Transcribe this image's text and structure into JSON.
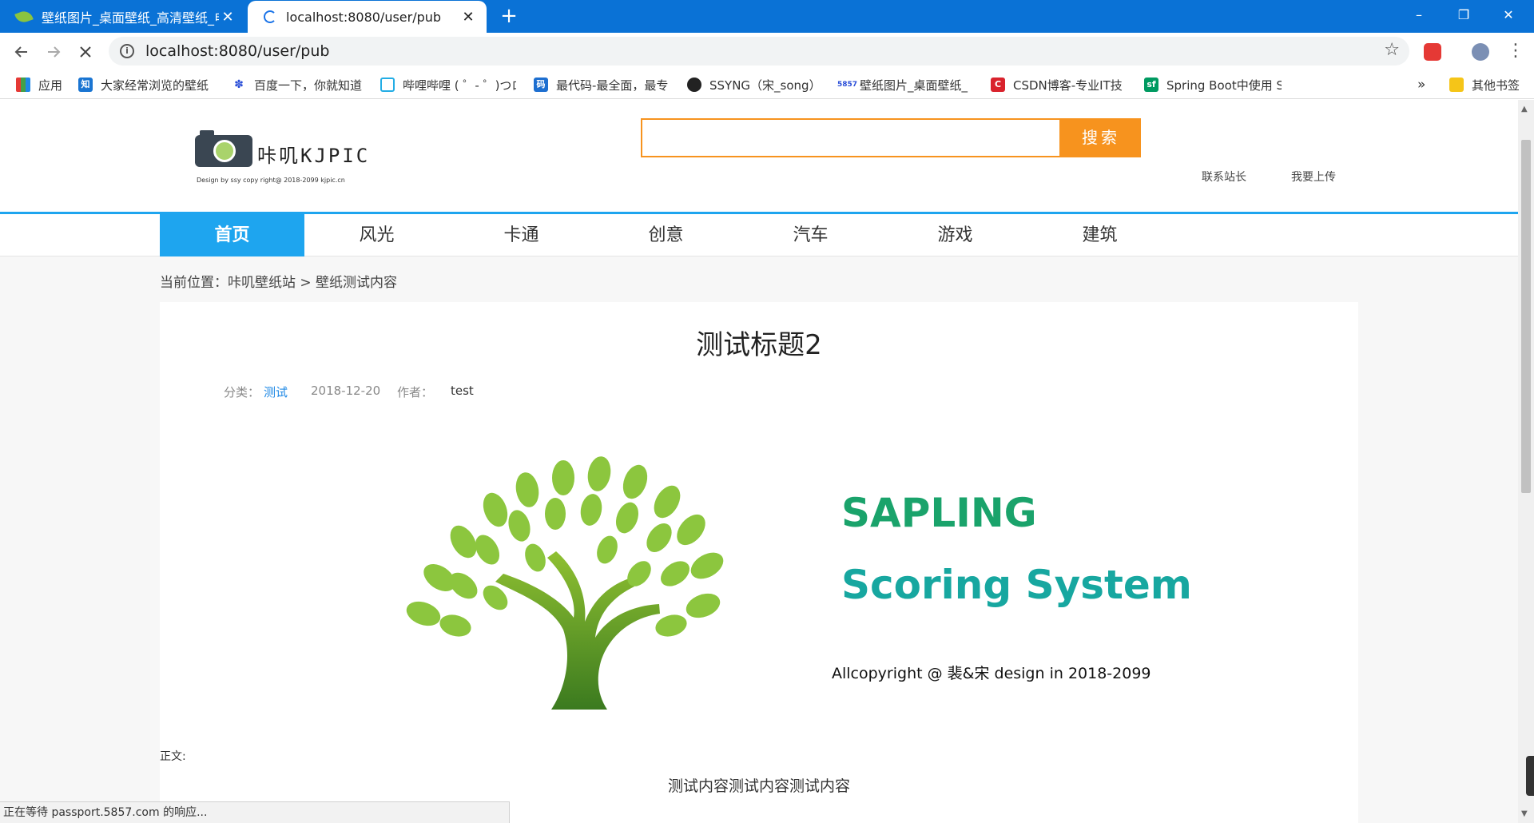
{
  "browser": {
    "tabs": [
      {
        "title": "壁纸图片_桌面壁纸_高清壁纸_电",
        "favicon": "leaf-icon",
        "active": false
      },
      {
        "title": "localhost:8080/user/pub",
        "favicon": "loading-icon",
        "active": true
      }
    ],
    "new_tab_label": "+",
    "window_controls": {
      "minimize": "–",
      "maximize": "❐",
      "close": "✕"
    },
    "url": "localhost:8080/user/pub",
    "bookmarks": [
      {
        "label": "应用",
        "icon": "apps-grid-icon"
      },
      {
        "label": "大家经常浏览的壁纸",
        "icon": "zhihu-icon"
      },
      {
        "label": "百度一下，你就知道",
        "icon": "baidu-paw-icon"
      },
      {
        "label": "哔哩哔哩 ( ゜- ゜)つロ",
        "icon": "bilibili-icon"
      },
      {
        "label": "最代码-最全面，最专",
        "icon": "zuidaima-icon"
      },
      {
        "label": "SSYNG（宋_song）",
        "icon": "github-icon"
      },
      {
        "label": "壁纸图片_桌面壁纸_",
        "icon": "5857-icon"
      },
      {
        "label": "CSDN博客-专业IT技",
        "icon": "csdn-icon"
      },
      {
        "label": "Spring Boot中使用 S",
        "icon": "segmentfault-icon"
      }
    ],
    "overflow_label": "»",
    "other_bookmarks": "其他书签",
    "status": "正在等待 passport.5857.com 的响应..."
  },
  "site": {
    "brand": "咔叽KJPIC",
    "tagline": "Design by ssy copy right@ 2018-2099  kjpic.cn",
    "search_button": "搜索",
    "search_placeholder": "",
    "links": {
      "contact": "联系站长",
      "upload": "我要上传"
    },
    "nav": [
      "首页",
      "风光",
      "卡通",
      "创意",
      "汽车",
      "游戏",
      "建筑"
    ],
    "nav_active_index": 0,
    "colors": {
      "accent_blue": "#1ea5ef",
      "accent_orange": "#f7931e",
      "category_link": "#1e88e5"
    }
  },
  "breadcrumb": "当前位置：咔叽壁纸站 > 壁纸测试内容",
  "article": {
    "title": "测试标题2",
    "category_label": "分类：",
    "category": "测试",
    "date": "2018-12-20",
    "author_label": "作者：",
    "author": "test",
    "image": {
      "line1": "SAPLING",
      "line2": "Scoring System",
      "copyright": "Allcopyright @ 裴&宋 design in 2018-2099"
    },
    "body_label": "正文:",
    "body": "测试内容测试内容测试内容"
  }
}
